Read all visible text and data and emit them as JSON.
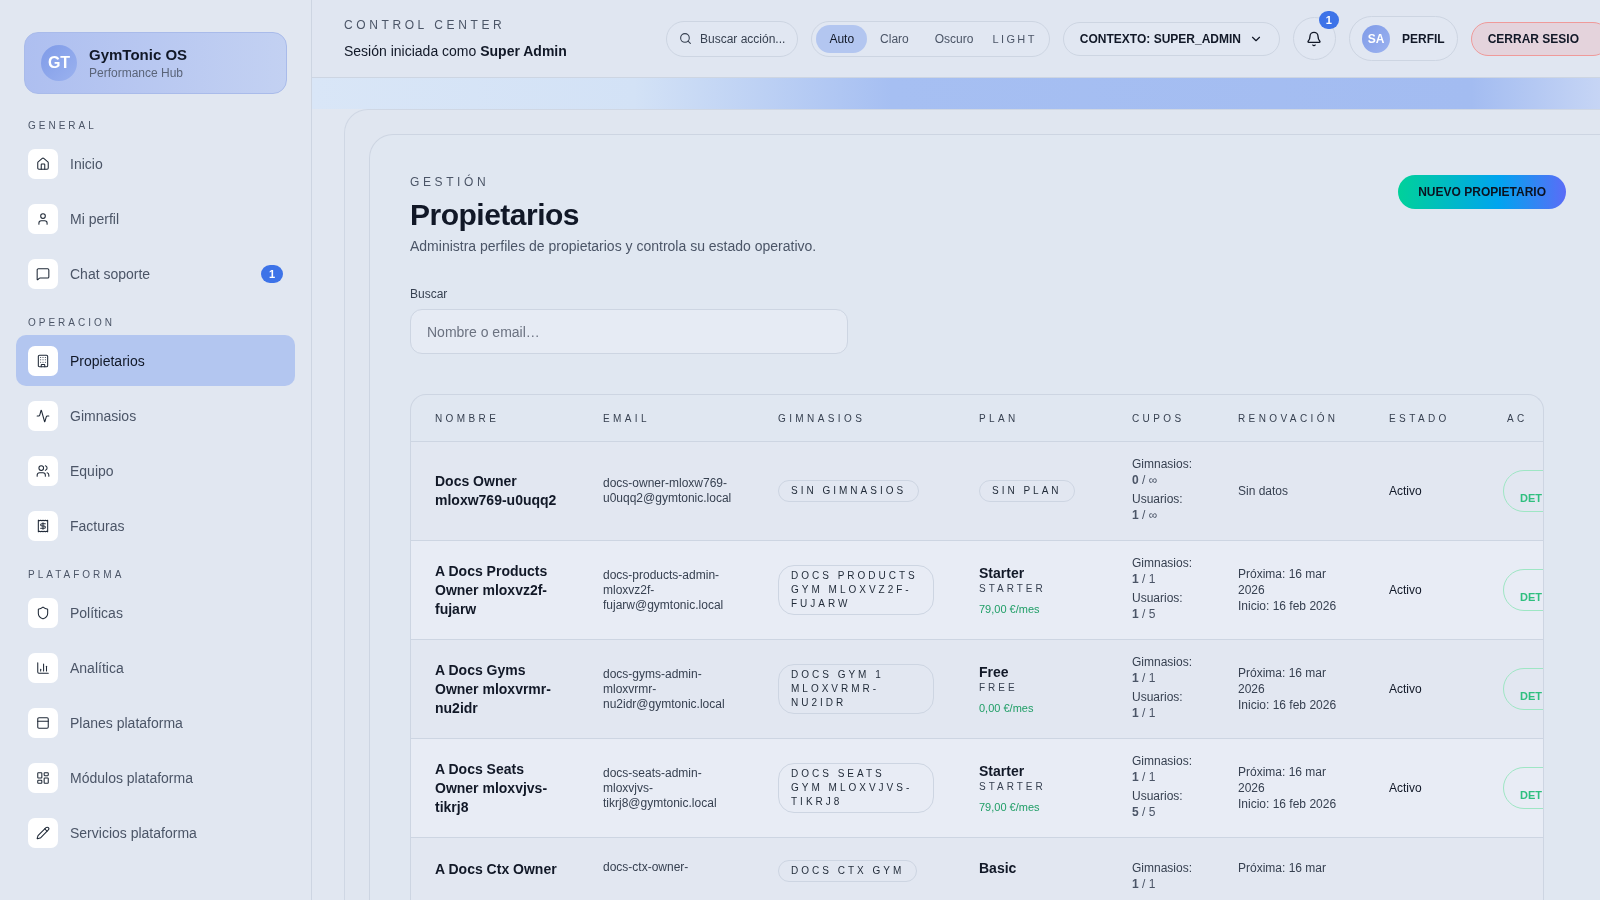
{
  "brand": {
    "initials": "GT",
    "name": "GymTonic OS",
    "subtitle": "Performance Hub"
  },
  "sidebar": {
    "sections": [
      {
        "title": "GENERAL",
        "items": [
          {
            "label": "Inicio",
            "selected": false
          },
          {
            "label": "Mi perfil",
            "selected": false
          },
          {
            "label": "Chat soporte",
            "selected": false,
            "badge": "1"
          }
        ]
      },
      {
        "title": "OPERACION",
        "items": [
          {
            "label": "Propietarios",
            "selected": true
          },
          {
            "label": "Gimnasios",
            "selected": false
          },
          {
            "label": "Equipo",
            "selected": false
          },
          {
            "label": "Facturas",
            "selected": false
          }
        ]
      },
      {
        "title": "PLATAFORMA",
        "items": [
          {
            "label": "Políticas",
            "selected": false
          },
          {
            "label": "Analítica",
            "selected": false
          },
          {
            "label": "Planes plataforma",
            "selected": false
          },
          {
            "label": "Módulos plataforma",
            "selected": false
          },
          {
            "label": "Servicios plataforma",
            "selected": false
          }
        ]
      }
    ]
  },
  "header": {
    "eyebrow": "CONTROL CENTER",
    "session": "Sesión iniciada como **Super Admin**",
    "search": {
      "placeholder": "Buscar acción..."
    },
    "theme": {
      "options": [
        {
          "label": "Auto",
          "selected": true
        },
        {
          "label": "Claro",
          "selected": false
        },
        {
          "label": "Oscuro",
          "selected": false
        }
      ],
      "current": "LIGHT"
    },
    "context": "CONTEXTO: SUPER_ADMIN",
    "notifications": "1",
    "profile": {
      "initials": "SA",
      "label": "PERFIL"
    },
    "logout": "CERRAR SESIO"
  },
  "page": {
    "eyebrow": "GESTIÓN",
    "title": "Propietarios",
    "description": "Administra perfiles de propietarios y controla su estado operativo.",
    "primary_action": "NUEVO PROPIETARIO",
    "search": {
      "label": "Buscar",
      "placeholder": "Nombre o email…"
    }
  },
  "table": {
    "columns": [
      "NOMBRE",
      "EMAIL",
      "GIMNASIOS",
      "PLAN",
      "CUPOS",
      "RENOVACIÓN",
      "ESTADO",
      "AC"
    ],
    "rows": [
      {
        "name": "Docs Owner mloxw769-u0uqq2",
        "email": "docs-owner-mloxw769-u0uqq2@gymtonic.local",
        "gyms": "SIN GIMNASIOS",
        "plan": {
          "kind": "none",
          "label": "SIN PLAN"
        },
        "quota": [
          {
            "label": "Gimnasios:",
            "value": "**0** / ∞"
          },
          {
            "label": "Usuarios:",
            "value": "**1** / ∞"
          }
        ],
        "renewal": [
          "Sin datos"
        ],
        "status": "Activo",
        "action": "DET"
      },
      {
        "name": "A Docs Products Owner mloxvz2f-fujarw",
        "email": "docs-products-admin-mloxvz2f-fujarw@gymtonic.local",
        "gyms": "DOCS PRODUCTS GYM MLOXVZ2F-FUJARW",
        "plan": {
          "kind": "plan",
          "name": "Starter",
          "code": "STARTER",
          "price": "79,00 €/mes"
        },
        "quota": [
          {
            "label": "Gimnasios:",
            "value": "**1** / 1"
          },
          {
            "label": "Usuarios:",
            "value": "**1** / 5"
          }
        ],
        "renewal": [
          "Próxima: 16 mar 2026",
          "Inicio: 16 feb 2026"
        ],
        "status": "Activo",
        "action": "DET"
      },
      {
        "name": "A Docs Gyms Owner mloxvrmr-nu2idr",
        "email": "docs-gyms-admin-mloxvrmr-nu2idr@gymtonic.local",
        "gyms": "DOCS GYM 1 MLOXVRMR-NU2IDR",
        "plan": {
          "kind": "plan",
          "name": "Free",
          "code": "FREE",
          "price": "0,00 €/mes"
        },
        "quota": [
          {
            "label": "Gimnasios:",
            "value": "**1** / 1"
          },
          {
            "label": "Usuarios:",
            "value": "**1** / 1"
          }
        ],
        "renewal": [
          "Próxima: 16 mar 2026",
          "Inicio: 16 feb 2026"
        ],
        "status": "Activo",
        "action": "DET"
      },
      {
        "name": "A Docs Seats Owner mloxvjvs-tikrj8",
        "email": "docs-seats-admin-mloxvjvs-tikrj8@gymtonic.local",
        "gyms": "DOCS SEATS GYM MLOXVJVS-TIKRJ8",
        "plan": {
          "kind": "plan",
          "name": "Starter",
          "code": "STARTER",
          "price": "79,00 €/mes"
        },
        "quota": [
          {
            "label": "Gimnasios:",
            "value": "**1** / 1"
          },
          {
            "label": "Usuarios:",
            "value": "**5** / 5"
          }
        ],
        "renewal": [
          "Próxima: 16 mar 2026",
          "Inicio: 16 feb 2026"
        ],
        "status": "Activo",
        "action": "DET"
      },
      {
        "name": "A Docs Ctx Owner",
        "email": "docs-ctx-owner-",
        "gyms": "DOCS CTX GYM",
        "plan": {
          "kind": "plan",
          "name": "Basic"
        },
        "quota": [
          {
            "label": "Gimnasios:",
            "value": "**1** / 1"
          }
        ],
        "renewal": [
          "Próxima: 16 mar"
        ]
      }
    ]
  }
}
